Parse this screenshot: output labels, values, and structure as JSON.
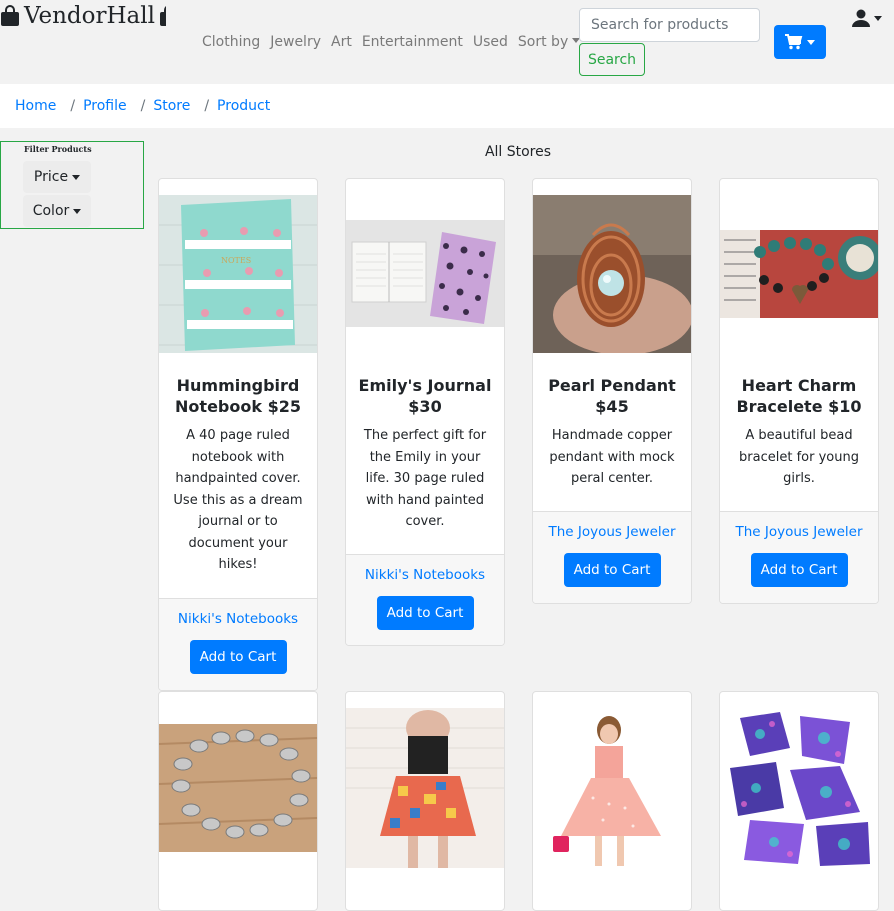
{
  "brand": {
    "name": "VendorHall"
  },
  "nav": {
    "links": [
      "Clothing",
      "Jewelry",
      "Art",
      "Entertainment",
      "Used"
    ],
    "sort_label": "Sort by"
  },
  "search": {
    "placeholder": "Search for products",
    "button_label": "Search"
  },
  "breadcrumb": [
    "Home",
    "Profile",
    "Store",
    "Product"
  ],
  "filter": {
    "title": "Filter Products",
    "price_label": "Price",
    "color_label": "Color"
  },
  "main": {
    "heading": "All Stores"
  },
  "products": [
    {
      "title": "Hummingbird Notebook $25",
      "description": "A 40 page ruled notebook with handpainted cover. Use this as a dream journal or to document your hikes!",
      "store": "Nikki's Notebooks",
      "button": "Add to Cart",
      "image_label": "NOTES"
    },
    {
      "title": "Emily's Journal $30",
      "description": "The perfect gift for the Emily in your life. 30 page ruled with hand painted cover.",
      "store": "Nikki's Notebooks",
      "button": "Add to Cart"
    },
    {
      "title": "Pearl Pendant $45",
      "description": "Handmade copper pendant with mock peral center.",
      "store": "The Joyous Jeweler",
      "button": "Add to Cart"
    },
    {
      "title": "Heart Charm Bracelete $10",
      "description": "A beautiful bead bracelet for young girls.",
      "store": "The Joyous Jeweler",
      "button": "Add to Cart"
    }
  ],
  "colors": {
    "primary": "#007bff",
    "success": "#28a745",
    "muted_nav": "#7a7a7a"
  }
}
